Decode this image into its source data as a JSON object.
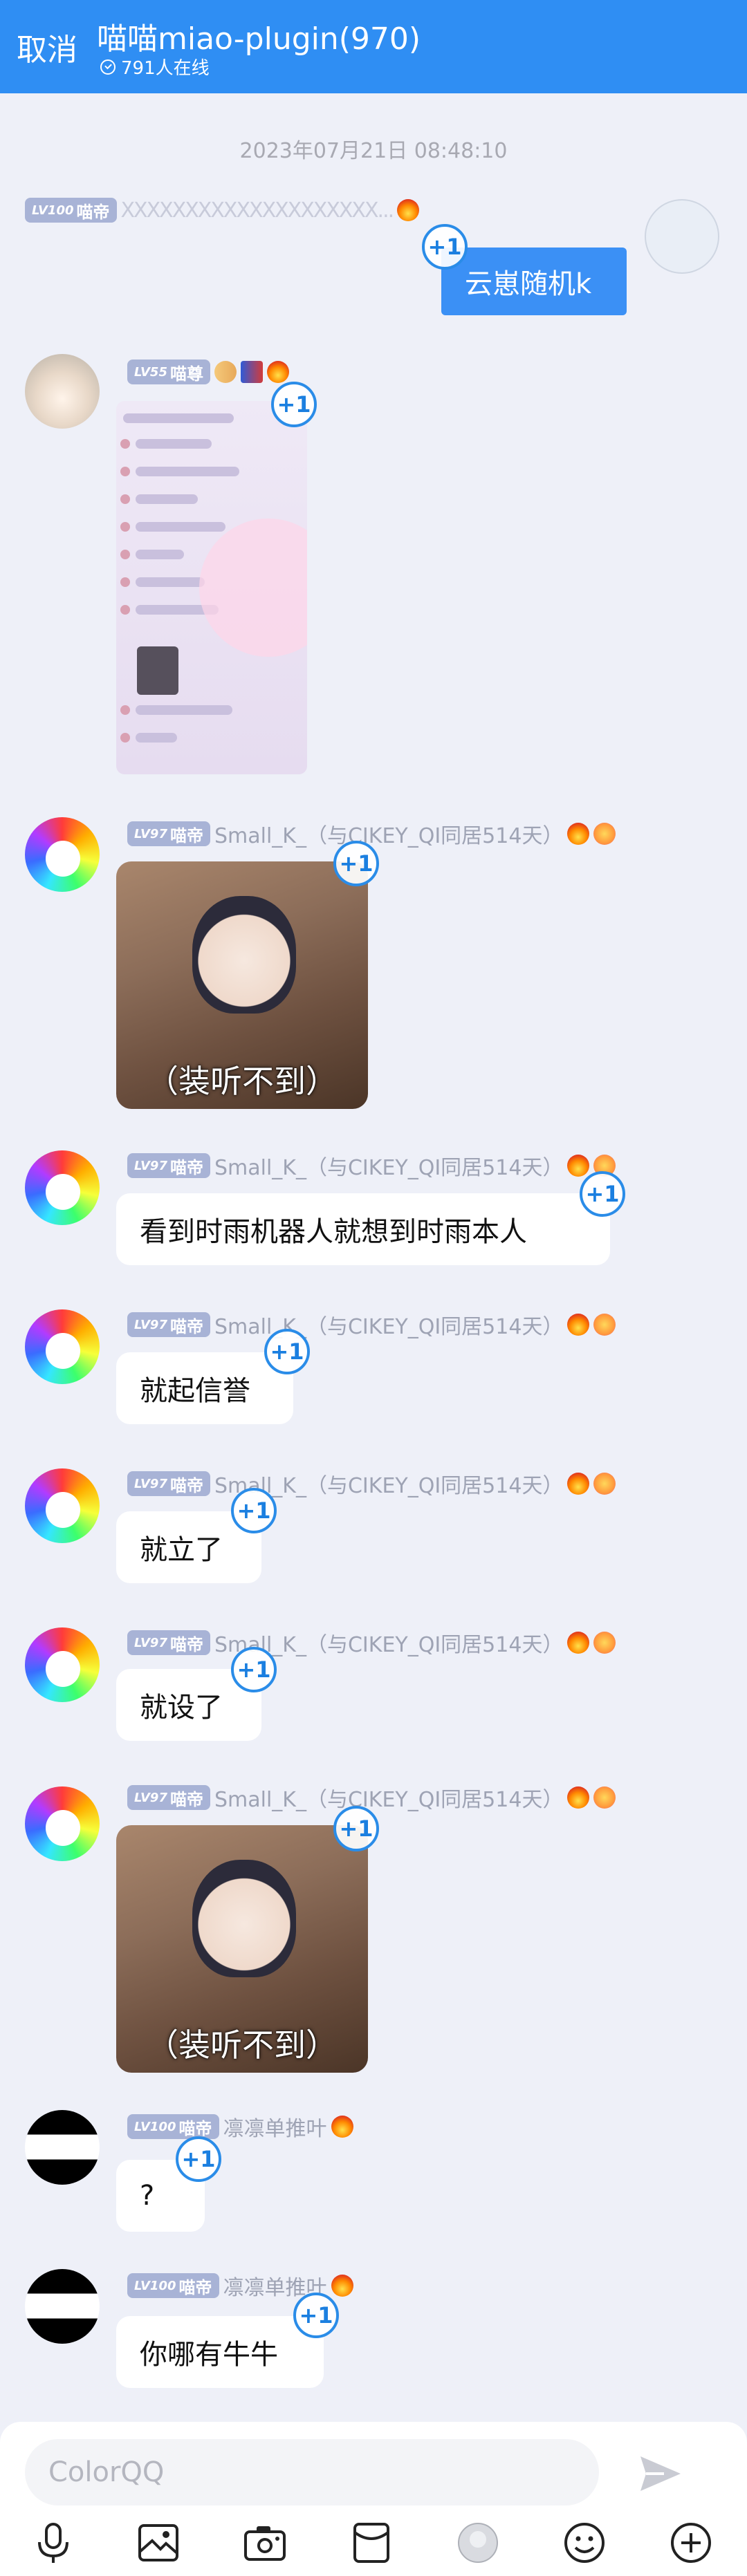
{
  "header": {
    "cancel_label": "取消",
    "title": "喵喵miao-plugin(970)",
    "online": "791人在线",
    "background": "#2f8ef3"
  },
  "timestamp": "2023年07月21日 08:48:10",
  "messages": [
    {
      "badge_level": "LV100",
      "badge_title": "喵帝",
      "sender": "XXXXXXXXXXXXXXXXXXXX...",
      "text": "云崽随机k",
      "plus": "+1",
      "own": true
    },
    {
      "badge_level": "LV55",
      "badge_title": "喵尊",
      "plus": "+1",
      "type": "image"
    },
    {
      "badge_level": "LV97",
      "badge_title": "喵帝",
      "sender": "Small_K_（与CIKEY_QI同居514天）",
      "image_caption": "（装听不到）",
      "plus": "+1",
      "type": "image"
    },
    {
      "badge_level": "LV97",
      "badge_title": "喵帝",
      "sender": "Small_K_（与CIKEY_QI同居514天）",
      "text": "看到时雨机器人就想到时雨本人",
      "plus": "+1"
    },
    {
      "badge_level": "LV97",
      "badge_title": "喵帝",
      "sender": "Small_K_（与CIKEY_QI同居514天）",
      "text": "就起信誉",
      "plus": "+1"
    },
    {
      "badge_level": "LV97",
      "badge_title": "喵帝",
      "sender": "Small_K_（与CIKEY_QI同居514天）",
      "text": "就立了",
      "plus": "+1"
    },
    {
      "badge_level": "LV97",
      "badge_title": "喵帝",
      "sender": "Small_K_（与CIKEY_QI同居514天）",
      "text": "就设了",
      "plus": "+1"
    },
    {
      "badge_level": "LV97",
      "badge_title": "喵帝",
      "sender": "Small_K_（与CIKEY_QI同居514天）",
      "image_caption": "（装听不到）",
      "plus": "+1",
      "type": "image"
    },
    {
      "badge_level": "LV100",
      "badge_title": "喵帝",
      "sender": "凛凛单推叶",
      "text": "?",
      "plus": "+1"
    },
    {
      "badge_level": "LV100",
      "badge_title": "喵帝",
      "sender": "凛凛单推叶",
      "text": "你哪有牛牛",
      "plus": "+1"
    }
  ],
  "input": {
    "placeholder": "ColorQQ"
  },
  "toolbar": {
    "icons": [
      "microphone-icon",
      "picture-icon",
      "camera-icon",
      "red-packet-icon",
      "avatar-icon",
      "emoji-icon",
      "plus-icon"
    ]
  }
}
